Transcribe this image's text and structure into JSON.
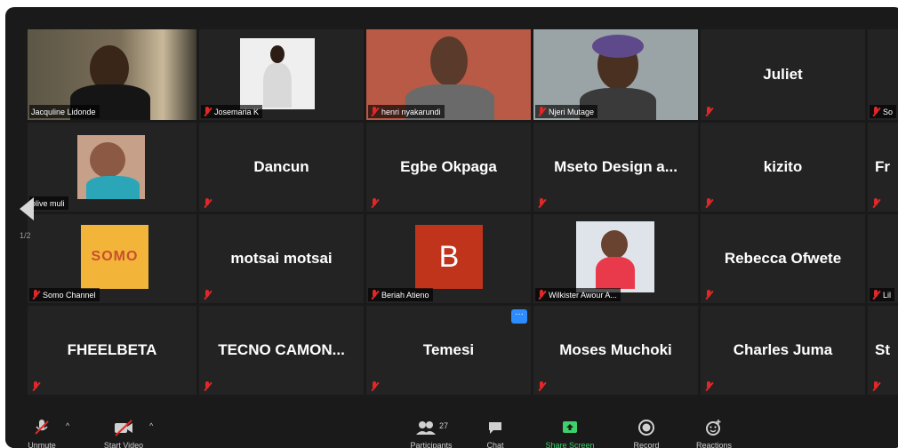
{
  "tiles": [
    {
      "name": "Jacquline Lidonde",
      "kind": "video"
    },
    {
      "name": "Josemaria K",
      "kind": "video"
    },
    {
      "name": "henri nyakarundi",
      "kind": "video"
    },
    {
      "name": "Njeri Mutage",
      "kind": "video"
    },
    {
      "name": "Juliet",
      "kind": "text"
    },
    {
      "name": "So",
      "kind": "partial"
    },
    {
      "name": "olive muli",
      "kind": "video"
    },
    {
      "name": "Dancun",
      "kind": "text"
    },
    {
      "name": "Egbe Okpaga",
      "kind": "text"
    },
    {
      "name": "Mseto Design a...",
      "kind": "text"
    },
    {
      "name": "kizito",
      "kind": "text"
    },
    {
      "name": "Fr",
      "kind": "partial"
    },
    {
      "name": "Somo Channel",
      "kind": "video",
      "logo_text": "SOMO"
    },
    {
      "name": "motsai motsai",
      "kind": "text"
    },
    {
      "name": "Beriah Atieno",
      "kind": "avatar",
      "initial": "B"
    },
    {
      "name": "Wilkister Awour A...",
      "kind": "video"
    },
    {
      "name": "Rebecca Ofwete",
      "kind": "text"
    },
    {
      "name": "Lil",
      "kind": "partial"
    },
    {
      "name": "FHEELBETA",
      "kind": "text"
    },
    {
      "name": "TECNO CAMON...",
      "kind": "text"
    },
    {
      "name": "Temesi",
      "kind": "text"
    },
    {
      "name": "Moses Muchoki",
      "kind": "text"
    },
    {
      "name": "Charles Juma",
      "kind": "text"
    },
    {
      "name": "St",
      "kind": "partial"
    }
  ],
  "pager": {
    "page": "1/2"
  },
  "toolbar": {
    "unmute": "Unmute",
    "start_video": "Start Video",
    "participants": "Participants",
    "participants_count": "27",
    "chat": "Chat",
    "share_screen": "Share Screen",
    "record": "Record",
    "reactions": "Reactions"
  },
  "colors": {
    "active_border": "#c7d84a",
    "avatar_bg": "#c0341c",
    "share_green": "#3dd06b",
    "mute_red": "#e02828"
  }
}
